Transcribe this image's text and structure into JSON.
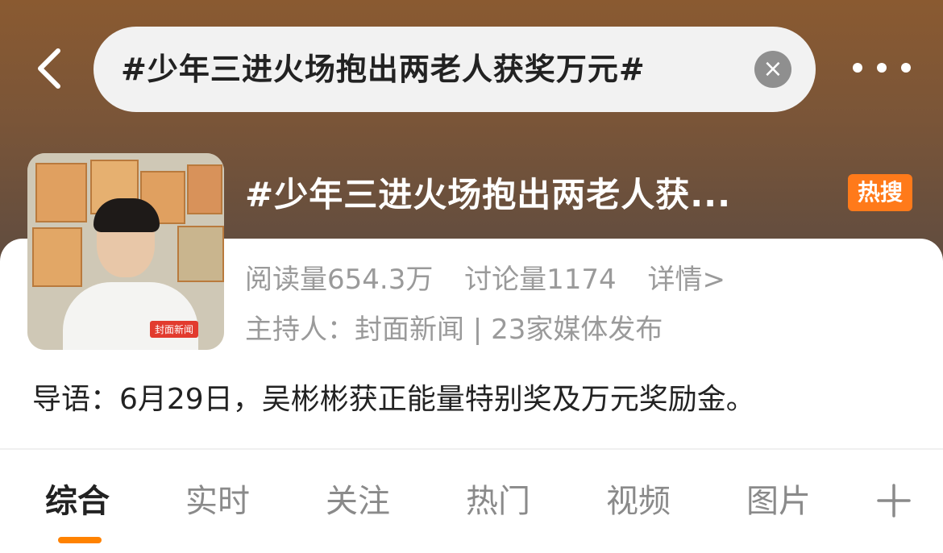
{
  "search": {
    "query": "#少年三进火场抱出两老人获奖万元#"
  },
  "icons": {
    "back": "chevron-left-icon",
    "clear": "close-icon",
    "more": "more-icon",
    "add": "plus-icon"
  },
  "topic": {
    "title": "#少年三进火场抱出两老人获...",
    "hot_badge": "热搜",
    "reads": "阅读量654.3万",
    "discussions": "讨论量1174",
    "details": "详情>",
    "host": "主持人：封面新闻 | 23家媒体发布",
    "thumbnail_watermark": "封面新闻",
    "intro": "导语：6月29日，吴彬彬获正能量特别奖及万元奖励金。"
  },
  "tabs": [
    {
      "label": "综合",
      "active": true
    },
    {
      "label": "实时",
      "active": false
    },
    {
      "label": "关注",
      "active": false
    },
    {
      "label": "热门",
      "active": false
    },
    {
      "label": "视频",
      "active": false
    },
    {
      "label": "图片",
      "active": false
    }
  ],
  "colors": {
    "accent": "#ff8200",
    "hot_badge": "#ff7a1a",
    "header_gradient_top": "#8a5a31",
    "header_gradient_bottom": "#5f4c40"
  }
}
